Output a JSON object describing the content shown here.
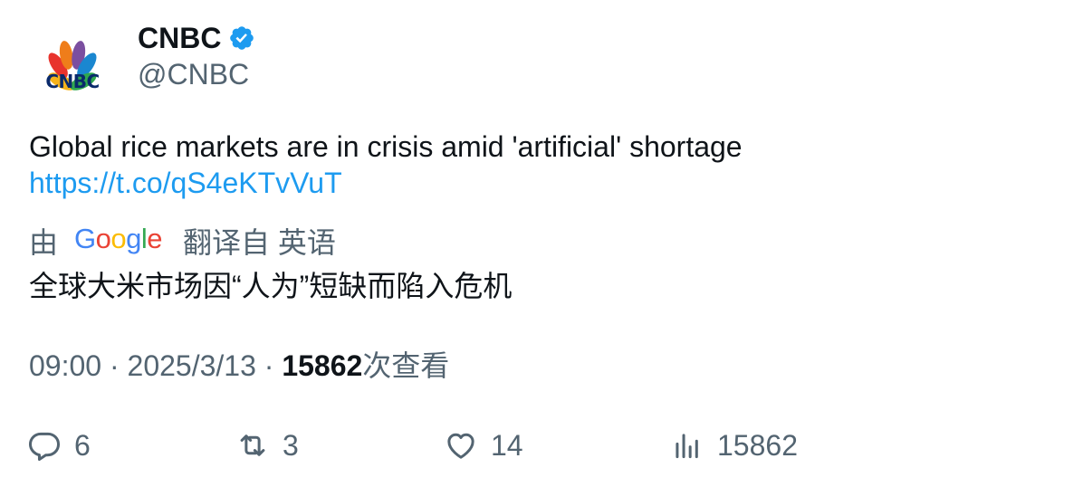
{
  "author": {
    "display_name": "CNBC",
    "handle": "@CNBC",
    "logo_text": "CNBC",
    "verified_color": "#1d9bf0"
  },
  "tweet": {
    "text": "Global rice markets are in crisis amid 'artificial' shortage",
    "link": "https://t.co/qS4eKTvVuT"
  },
  "translation": {
    "prefix": "由",
    "provider": "Google",
    "suffix": "翻译自 英语",
    "text": "全球大米市场因“人为”短缺而陷入危机"
  },
  "meta": {
    "time": "09:00",
    "separator1": " · ",
    "date": "2025/3/13",
    "separator2": " · ",
    "views": "15862",
    "views_label": "次查看"
  },
  "actions": {
    "replies": "6",
    "retweets": "3",
    "likes": "14",
    "views": "15862"
  },
  "colors": {
    "text": "#0f1419",
    "secondary": "#536471",
    "link": "#1d9bf0"
  }
}
